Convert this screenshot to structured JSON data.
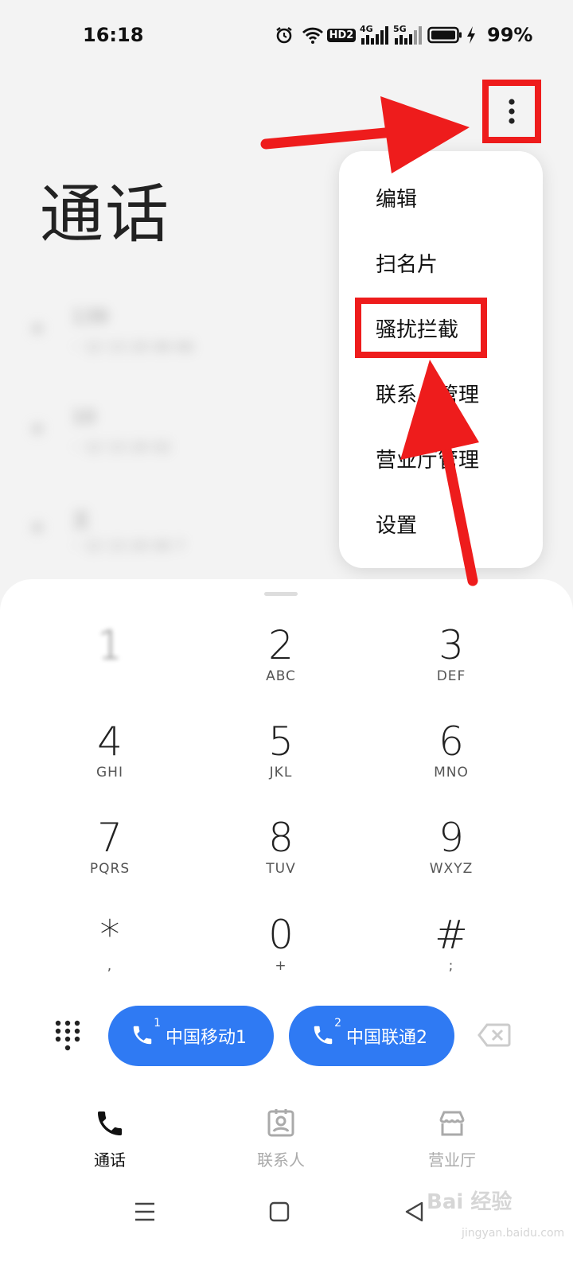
{
  "status_bar": {
    "time": "16:18",
    "hd_label": "HD2",
    "net1": "4G",
    "net2": "5G",
    "battery": "99%",
    "icons": [
      "alarm-icon",
      "wifi-icon",
      "hd-icon",
      "signal-4g-icon",
      "signal-5g-icon",
      "battery-icon",
      "charging-icon"
    ]
  },
  "header": {
    "title": "通话"
  },
  "menu": {
    "items": [
      {
        "label": "编辑"
      },
      {
        "label": "扫名片"
      },
      {
        "label": "骚扰拦截"
      },
      {
        "label": "联系人管理"
      },
      {
        "label": "营业厅管理"
      },
      {
        "label": "设置"
      }
    ]
  },
  "call_list": {
    "rows": [
      {
        "name": "139",
        "number": "◦ 12 13 20 06 66"
      },
      {
        "name": "10",
        "number": "◦ 12 13 20 02"
      },
      {
        "name": "王 ",
        "number": "◦ 12 13 20 00 7"
      }
    ]
  },
  "dialpad": {
    "keys": [
      {
        "digit": "1",
        "letters": ""
      },
      {
        "digit": "2",
        "letters": "ABC"
      },
      {
        "digit": "3",
        "letters": "DEF"
      },
      {
        "digit": "4",
        "letters": "GHI"
      },
      {
        "digit": "5",
        "letters": "JKL"
      },
      {
        "digit": "6",
        "letters": "MNO"
      },
      {
        "digit": "7",
        "letters": "PQRS"
      },
      {
        "digit": "8",
        "letters": "TUV"
      },
      {
        "digit": "9",
        "letters": "WXYZ"
      },
      {
        "digit": "*",
        "letters": ","
      },
      {
        "digit": "0",
        "letters": "+"
      },
      {
        "digit": "#",
        "letters": ";"
      }
    ]
  },
  "sim_buttons": [
    {
      "slot": "1",
      "label": "中国移动1"
    },
    {
      "slot": "2",
      "label": "中国联通2"
    }
  ],
  "bottom_nav": {
    "tabs": [
      {
        "label": "通话"
      },
      {
        "label": "联系人"
      },
      {
        "label": "营业厅"
      }
    ]
  },
  "watermark": {
    "brand": "Bai 经验",
    "url": "jingyan.baidu.com"
  },
  "colors": {
    "accent": "#2f7af3",
    "annotation": "#ee1c1c",
    "active_tab": "#111111",
    "inactive_tab": "#aaaaaa"
  }
}
